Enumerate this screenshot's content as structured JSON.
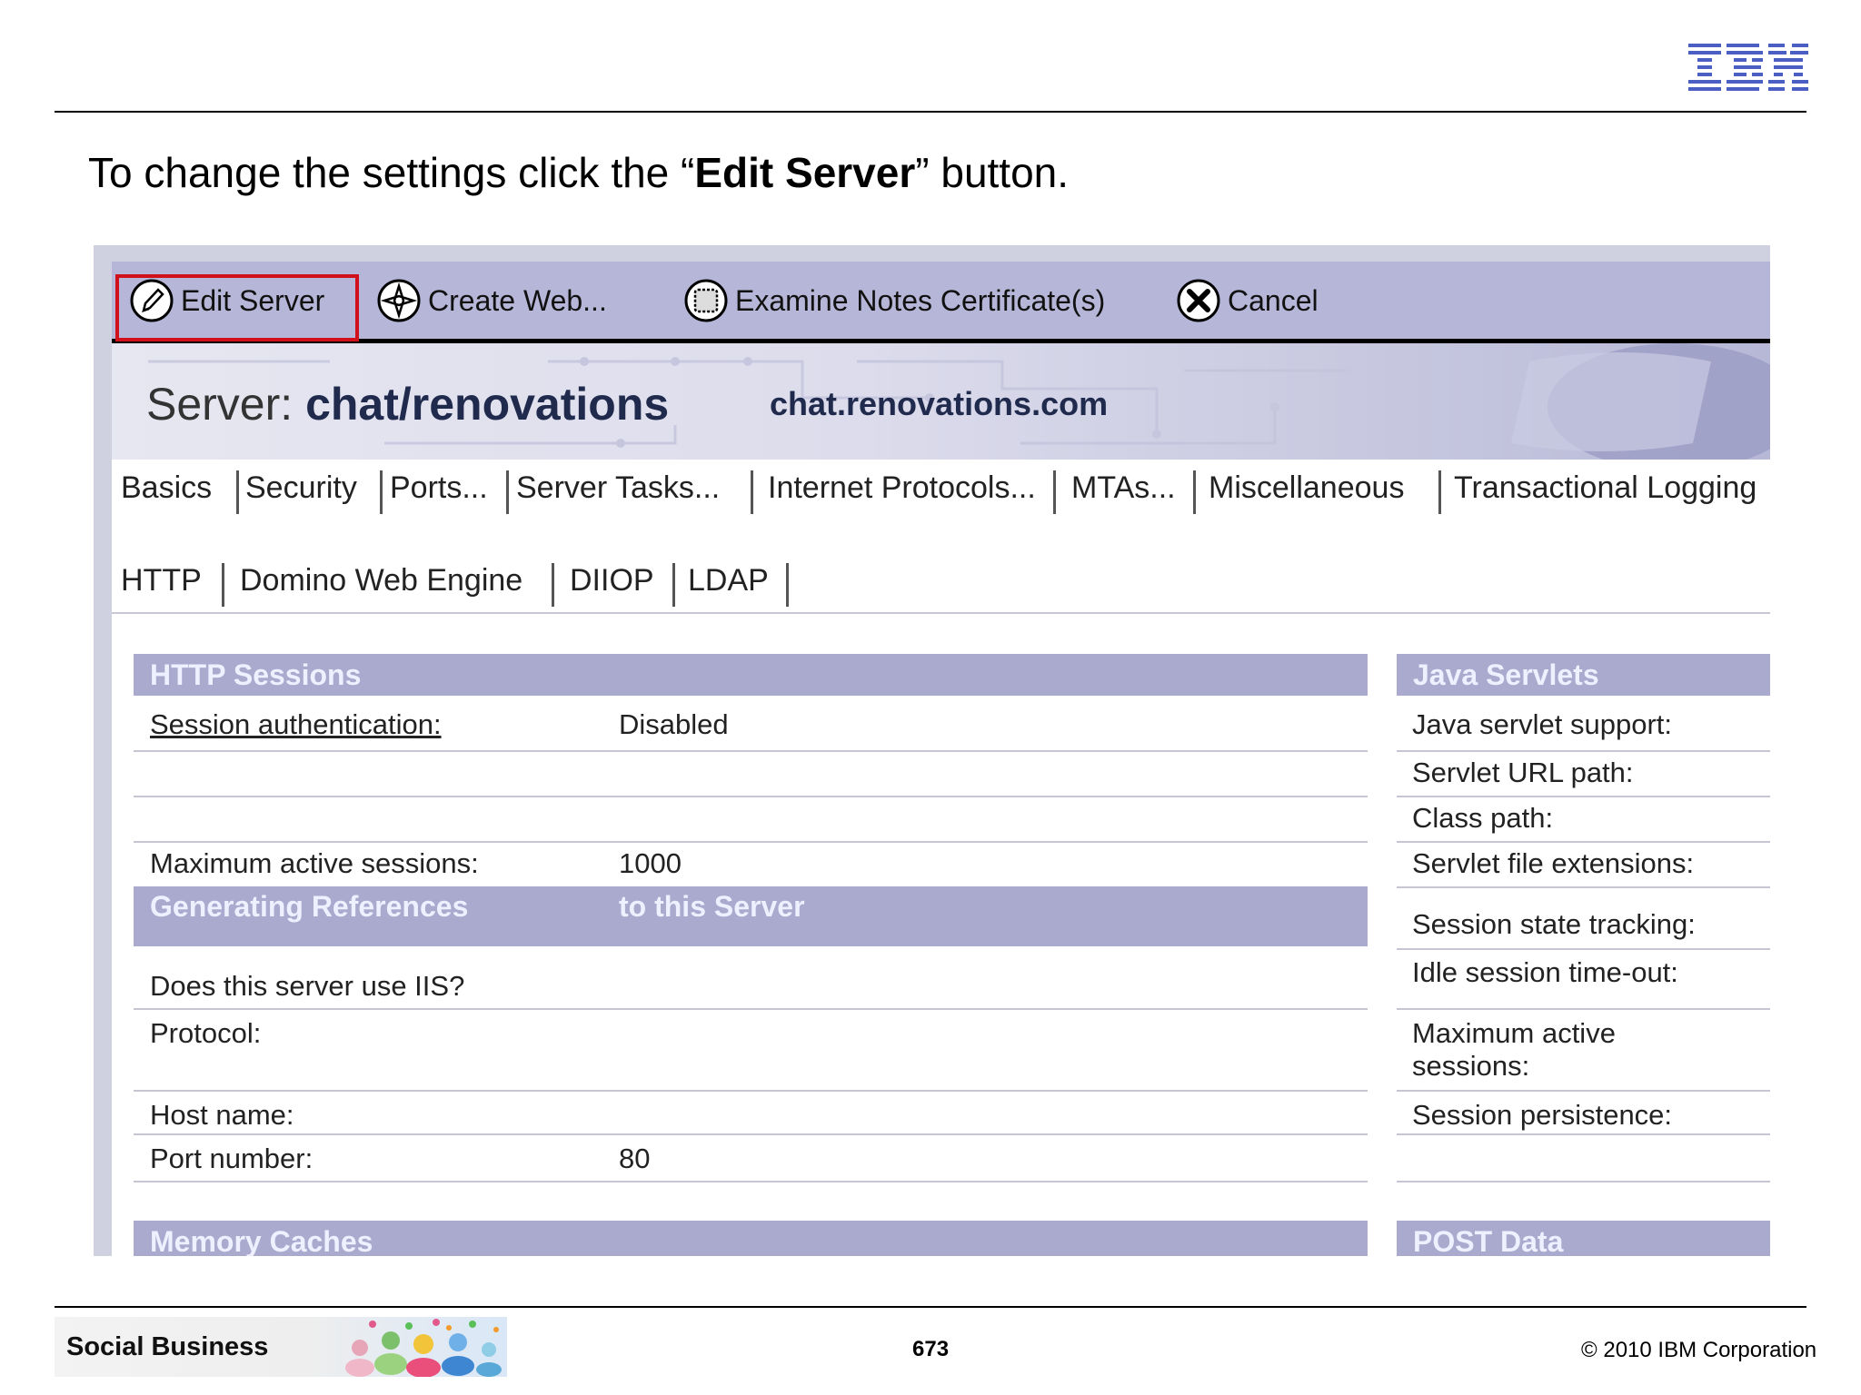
{
  "slide": {
    "logo_text": "IBM",
    "instruction": {
      "before": "To change the settings click the “",
      "bold": "Edit Server",
      "after": "” button."
    }
  },
  "toolbar": {
    "edit_server": "Edit Server",
    "create_web": "Create Web...",
    "examine_certs": "Examine Notes Certificate(s)",
    "cancel": "Cancel"
  },
  "banner": {
    "label": "Server:",
    "server_name": "chat/renovations",
    "host": "chat.renovations.com"
  },
  "tabs": [
    "Basics",
    "Security",
    "Ports...",
    "Server Tasks...",
    "Internet Protocols...",
    "MTAs...",
    "Miscellaneous",
    "Transactional Logging"
  ],
  "subtabs": [
    "HTTP",
    "Domino Web Engine",
    "DIIOP",
    "LDAP"
  ],
  "sections": {
    "http_sessions": "HTTP Sessions",
    "generating_refs_a": "Generating References",
    "generating_refs_b": "to this Server",
    "memory_caches": "Memory Caches",
    "java_servlets": "Java Servlets",
    "post_data": "POST Data"
  },
  "http_sessions": {
    "session_auth_label": "Session authentication:",
    "session_auth_value": "Disabled",
    "max_sessions_label": "Maximum active sessions:",
    "max_sessions_value": "1000"
  },
  "references": {
    "iis_label": "Does this server use IIS?",
    "protocol_label": "Protocol:",
    "host_label": "Host name:",
    "port_label": "Port number:",
    "port_value": "80"
  },
  "java_servlets": {
    "support": "Java servlet support:",
    "url_path": "Servlet URL path:",
    "class_path": "Class path:",
    "file_ext": "Servlet file extensions:",
    "state_tracking": "Session state tracking:",
    "idle_timeout": "Idle session time-out:",
    "max_active_1": "Maximum active",
    "max_active_2": "sessions:",
    "persistence": "Session persistence:"
  },
  "footer": {
    "brand": "Social Business",
    "page_number": "673",
    "copyright": "© 2010 IBM Corporation"
  },
  "colors": {
    "toolbar_bg": "#b6b7d8",
    "section_bar": "#a9aace",
    "highlight_border": "#d0101a",
    "ibm_blue": "#4a5fc1"
  }
}
